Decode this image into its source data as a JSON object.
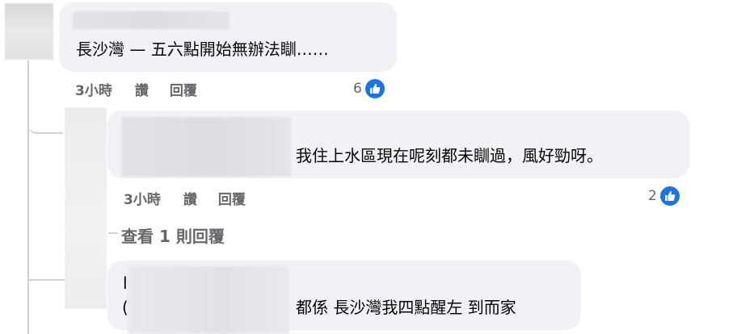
{
  "comments": [
    {
      "text": "長沙灣 — 五六點開始無辦法瞓……",
      "time": "3小時",
      "read_label": "讚",
      "reply_label": "回覆",
      "like_count": "6"
    },
    {
      "text": "我住上水區現在呢刻都未瞓過，風好勁呀。",
      "time": "3小時",
      "read_label": "讚",
      "reply_label": "回覆",
      "like_count": "2"
    },
    {
      "text": "都係 長沙灣我四點醒左 到而家",
      "stray_chars": [
        "l",
        "("
      ]
    }
  ],
  "view_more_replies": "查看 1 則回覆",
  "colors": {
    "bubble": "#f0f2f5",
    "meta_text": "#65676b",
    "like_blue": "#1b74e4",
    "thread_line": "#ced0d4"
  },
  "icons": {
    "like": "thumbs-up-icon"
  }
}
